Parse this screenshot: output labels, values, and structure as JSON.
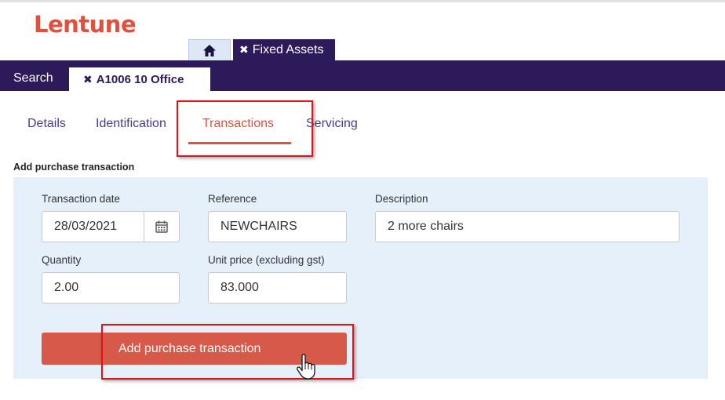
{
  "app": {
    "logo": "Lentune"
  },
  "top_tabs": [
    {
      "icon": "home-icon"
    },
    {
      "close_glyph": "✖",
      "label": "Fixed Assets"
    }
  ],
  "nav": {
    "search_label": "Search",
    "record_tab": {
      "close_glyph": "✖",
      "label": "A1006 10 Office"
    }
  },
  "sub_tabs": [
    {
      "label": "Details"
    },
    {
      "label": "Identification"
    },
    {
      "label": "Transactions",
      "active": true
    },
    {
      "label": "Servicing"
    }
  ],
  "form": {
    "title": "Add purchase transaction",
    "transaction_date": {
      "label": "Transaction date",
      "value": "28/03/2021",
      "icon": "calendar-icon"
    },
    "reference": {
      "label": "Reference",
      "value": "NEWCHAIRS"
    },
    "description": {
      "label": "Description",
      "value": "2 more chairs"
    },
    "quantity": {
      "label": "Quantity",
      "value": "2.00"
    },
    "unit_price": {
      "label": "Unit price (excluding gst)",
      "value": "83.000"
    },
    "submit_label": "Add purchase transaction"
  },
  "colors": {
    "brand": "#e1503d",
    "nav": "#2d1a5a",
    "panel": "#e6f0fb",
    "button": "#d6594a",
    "highlight": "#e0131c"
  }
}
